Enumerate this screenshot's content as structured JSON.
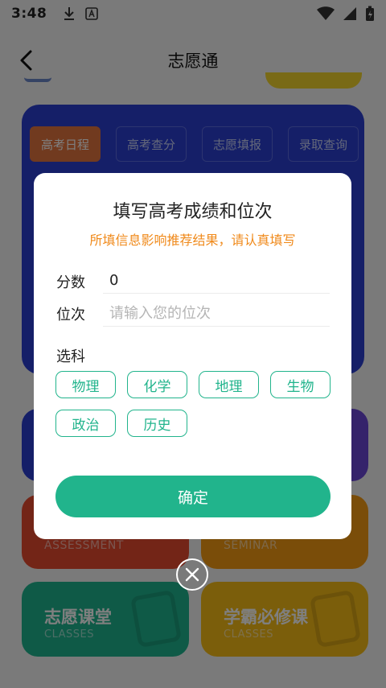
{
  "status_bar": {
    "time": "3:48"
  },
  "header": {
    "title": "志愿通"
  },
  "tabs": [
    "高考日程",
    "高考查分",
    "志愿填报",
    "录取查询"
  ],
  "cards": {
    "red_sub": "ASSESSMENT",
    "orange_sub": "SEMINAR",
    "teal_title": "志愿课堂",
    "teal_sub": "CLASSES",
    "yellow_title": "学霸必修课",
    "yellow_sub": "CLASSES"
  },
  "modal": {
    "title": "填写高考成绩和位次",
    "subtitle": "所填信息影响推荐结果，请认真填写",
    "score_label": "分数",
    "score_value": "0",
    "rank_label": "位次",
    "rank_placeholder": "请输入您的位次",
    "subjects_label": "选科",
    "subjects": [
      "物理",
      "化学",
      "地理",
      "生物",
      "政治",
      "历史"
    ],
    "confirm_label": "确定"
  },
  "colors": {
    "accent": "#21b48c",
    "warning": "#f08a1b"
  }
}
